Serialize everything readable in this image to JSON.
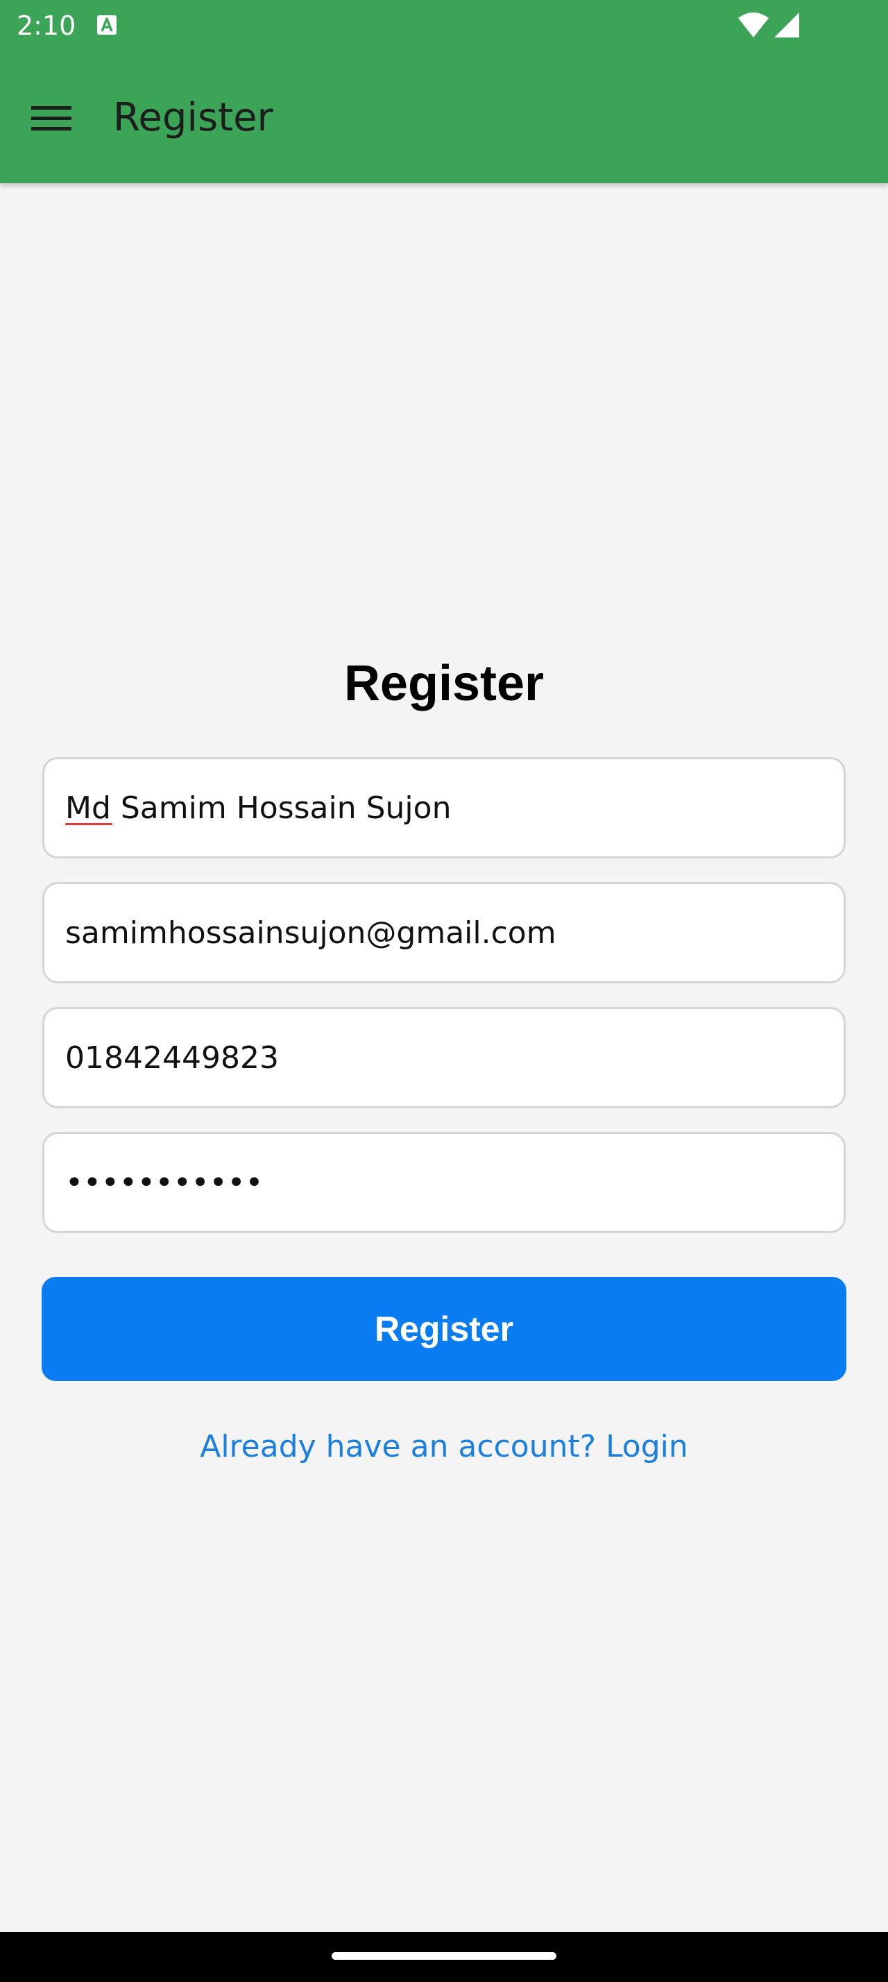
{
  "status_bar": {
    "time": "2:10",
    "notification_icon": "text-a-notification-icon",
    "wifi_icon": "wifi-icon",
    "signal_icon": "cell-signal-icon"
  },
  "app_bar": {
    "menu_icon": "hamburger-menu-icon",
    "title": "Register"
  },
  "form": {
    "heading": "Register",
    "name_value": "Md Samim Hossain Sujon",
    "email_value": "samimhossainsujon@gmail.com",
    "phone_value": "01842449823",
    "password_value": "•••••••••••",
    "submit_label": "Register",
    "login_link_label": "Already have an account? Login"
  },
  "colors": {
    "app_bar": "#3ca457",
    "primary_button": "#0a7cf2",
    "link": "#1a7fe0",
    "background": "#f4f4f4"
  }
}
